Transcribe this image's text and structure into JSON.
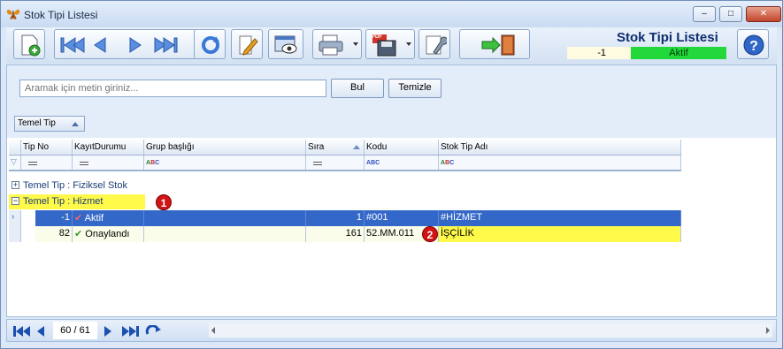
{
  "window": {
    "title": "Stok Tipi Listesi",
    "min": "–",
    "max": "□",
    "close": "✕"
  },
  "toolbar": {
    "heading": "Stok Tipi Listesi",
    "record_id": "-1",
    "record_status": "Aktif",
    "pdf_label": "PDF"
  },
  "search": {
    "placeholder": "Aramak için metin giriniz...",
    "find_label": "Bul",
    "clear_label": "Temizle"
  },
  "group_panel": {
    "chip_label": "Temel Tip"
  },
  "grid": {
    "columns": [
      "Tip No",
      "KayıtDurumu",
      "Grup başlığı",
      "Sıra",
      "Kodu",
      "Stok Tip Adı"
    ],
    "groups": [
      {
        "label": "Temel Tip : Fiziksel Stok",
        "expander": "+"
      },
      {
        "label": "Temel Tip : Hizmet",
        "expander": "−",
        "badge": "1"
      }
    ],
    "rows": [
      {
        "tip_no": "-1",
        "status": "Aktif",
        "status_mark": "✔",
        "group": "",
        "sira": "1",
        "kodu": "#001",
        "ad": "#HİZMET"
      },
      {
        "tip_no": "82",
        "status": "Onaylandı",
        "status_mark": "✔",
        "group": "",
        "sira": "161",
        "kodu": "52.MM.011",
        "ad": "İŞÇİLİK",
        "badge": "2"
      }
    ]
  },
  "nav": {
    "page": "60 / 61"
  },
  "colors": {
    "selected_row": "#3468c8",
    "highlight": "#fff94a",
    "status_ok": "#22d83a",
    "badge": "#d11414"
  }
}
